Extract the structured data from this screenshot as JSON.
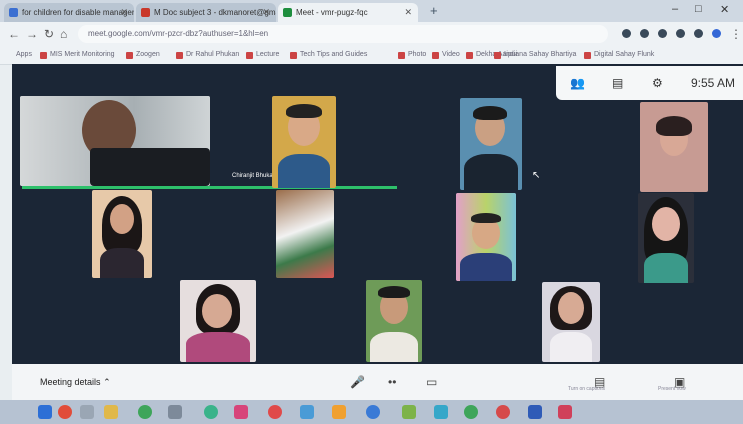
{
  "browser": {
    "tabs": [
      {
        "title": "for children for disable manager",
        "color": "#3b6fd1",
        "active": false
      },
      {
        "title": "M  Doc subject 3 - dkmanoret@gmail",
        "color": "#c9382a",
        "active": false
      },
      {
        "title": "Meet - vmr-pugz-fqc",
        "color": "#1e8e3e",
        "active": true
      }
    ],
    "new_tab": "+",
    "window_controls": [
      "–",
      "□",
      "✕"
    ],
    "url": "meet.google.com/vmr-pzcr-dbz?authuser=1&hl=en",
    "bookmarks": [
      "Apps",
      "MIS Merit Monitoring",
      "Zoogen",
      "Dr Rahul Phukan",
      "Lecture",
      "Tech Tips and Guides",
      "Photo",
      "Video",
      "Dekha Aaipui",
      "Indiana Sahay Bhartiya",
      "Digital Sahay Flunk"
    ]
  },
  "meet": {
    "controls_icons": [
      "people-icon",
      "chat-icon",
      "activities-icon"
    ],
    "time": "9:55 AM",
    "active_speaker_name": "Chiranjit Bhukan",
    "meeting_details": "Meeting details",
    "bottom_controls": [
      "mic-icon",
      "end-call-icon",
      "camera-icon"
    ],
    "bottom_small_labels": [
      "Turn on captions",
      "Present now"
    ]
  },
  "taskbar": {
    "icons": [
      "windows-start-icon",
      "search-icon",
      "taskview-icon",
      "file-explorer-icon",
      "chrome-icon",
      "store-icon",
      "edge-icon",
      "mail-icon",
      "photos-icon",
      "opera-icon",
      "media-icon",
      "vlc-icon",
      "headset-icon",
      "pen-icon",
      "terminal-icon",
      "chrome-icon",
      "meet-icon",
      "word-icon",
      "app-icon"
    ]
  }
}
